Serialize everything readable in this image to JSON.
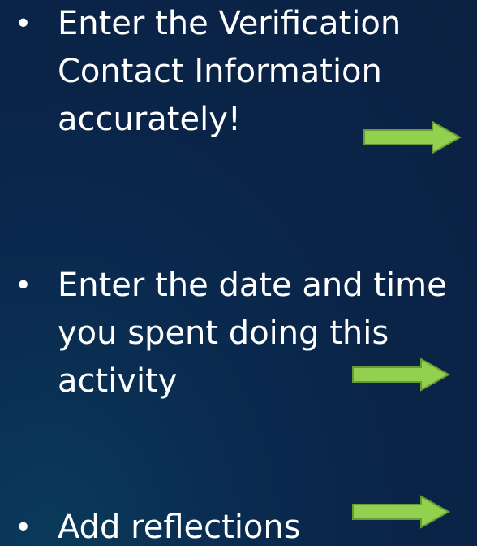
{
  "bullets": [
    {
      "text": "Enter the Verification\nContact Information\naccurately!"
    },
    {
      "text": "Enter the date and time\nyou spent doing this\nactivity"
    },
    {
      "text": "Add reflections"
    }
  ],
  "bullet_marker": "•",
  "icons": [
    "right-arrow-icon",
    "right-arrow-icon",
    "right-arrow-icon"
  ],
  "colors": {
    "background": "#0b2548",
    "text": "#ffffff",
    "arrow_fill": "#92d050",
    "arrow_stroke": "#6a9a35"
  }
}
